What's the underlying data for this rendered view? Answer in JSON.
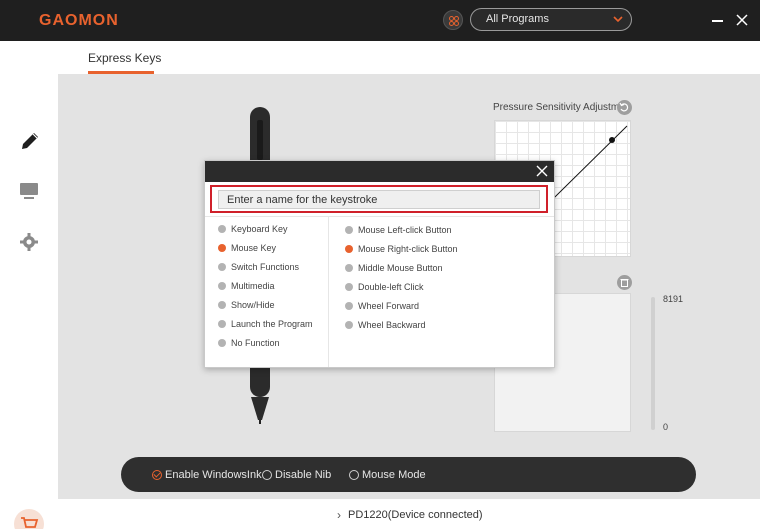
{
  "app": {
    "brand": "GAOMON",
    "program_select": "All Programs"
  },
  "tabs": [
    {
      "label": "Express Keys"
    }
  ],
  "pressure": {
    "title": "Pressure Sensitivity Adjustm...",
    "level_max": "8191",
    "level_min": "0"
  },
  "options": {
    "windows_ink": "Enable WindowsInk",
    "disable_nib": "Disable Nib",
    "mouse_mode": "Mouse Mode",
    "windows_ink_checked": true
  },
  "status": {
    "device": "PD1220(Device connected)"
  },
  "dialog": {
    "name_placeholder": "Enter a name for the keystroke",
    "categories": [
      {
        "label": "Keyboard Key",
        "active": false
      },
      {
        "label": "Mouse Key",
        "active": true
      },
      {
        "label": "Switch Functions",
        "active": false
      },
      {
        "label": "Multimedia",
        "active": false
      },
      {
        "label": "Show/Hide",
        "active": false
      },
      {
        "label": "Launch the Program",
        "active": false
      },
      {
        "label": "No Function",
        "active": false
      }
    ],
    "mouse_options": [
      {
        "label": "Mouse Left-click Button",
        "active": false
      },
      {
        "label": "Mouse Right-click Button",
        "active": true
      },
      {
        "label": "Middle Mouse Button",
        "active": false
      },
      {
        "label": "Double-left Click",
        "active": false
      },
      {
        "label": "Wheel Forward",
        "active": false
      },
      {
        "label": "Wheel Backward",
        "active": false
      }
    ]
  },
  "colors": {
    "accent": "#e8622e",
    "titlebar": "#1f1f1f",
    "highlight_border": "#d0202a"
  },
  "icons": {
    "sidebar": [
      "pen-icon",
      "monitor-icon",
      "gear-icon"
    ],
    "cart": "cart-icon"
  }
}
